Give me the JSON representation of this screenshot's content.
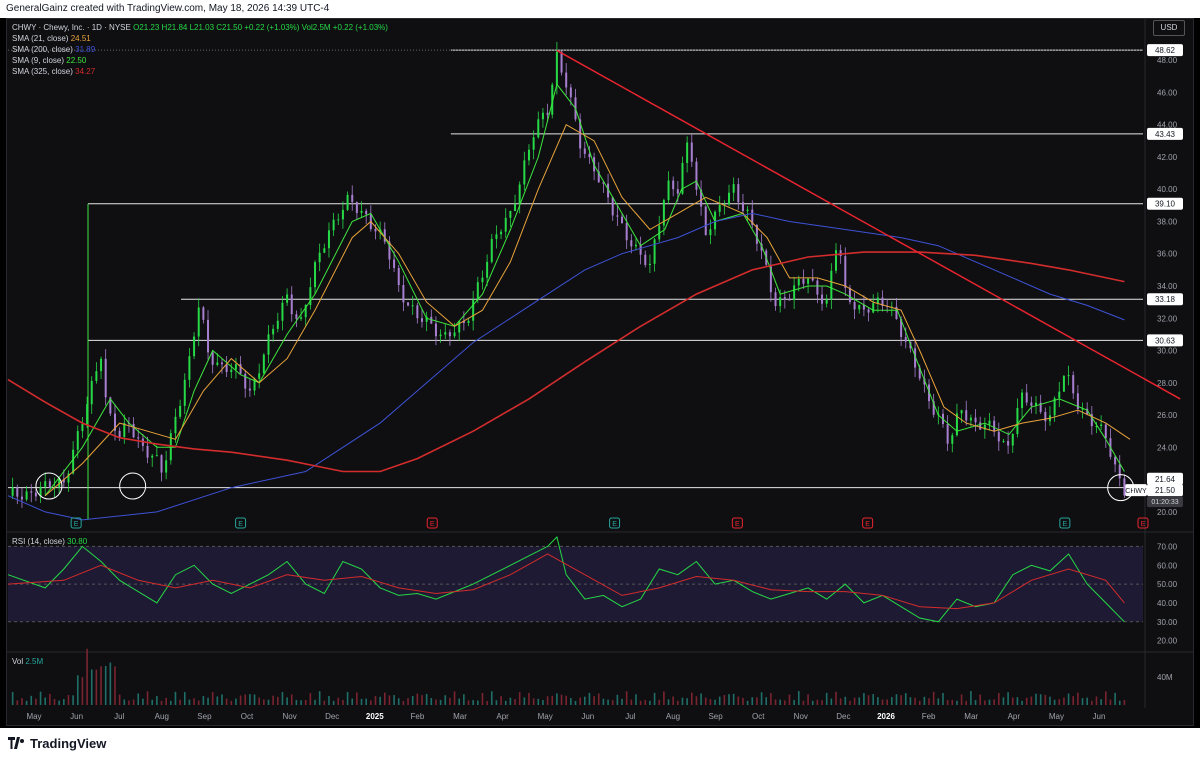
{
  "header": {
    "text": "GeneralGainz created with TradingView.com, May 18, 2026 14:39 UTC-4"
  },
  "legend": {
    "symbol_line": "CHWY · Chewy, Inc. · 1D · NYSE",
    "ohlc": "O21.23 H21.84 L21.03 C21.50 +0.22 (+1.03%) Vol2.5M +0.22 (+1.03%)",
    "sma1_label": "SMA (21, close)",
    "sma1_value": "24.51",
    "sma2_label": "SMA (200, close)",
    "sma2_value": "31.89",
    "sma3_label": "SMA (9, close)",
    "sma3_value": "22.50",
    "sma4_label": "SMA (325, close)",
    "sma4_value": "34.27"
  },
  "currency": "USD",
  "rsi_label": "RSI (14, close)",
  "rsi_value": "30.80",
  "vol_label": "Vol",
  "vol_value": "2.5M",
  "footer": {
    "brand": "TradingView"
  },
  "colors": {
    "up": "#26d946",
    "down": "#a87fd0",
    "sma21": "#e8a33a",
    "sma200": "#3d52d5",
    "sma9": "#3ee63e",
    "sma325": "#d32c2c",
    "trendline": "#e8242e",
    "rsi": "#26d946",
    "rsi_ma": "#d32c2c"
  },
  "chart_data": {
    "type": "line",
    "title": "CHWY · Chewy, Inc. · 1D · NYSE",
    "x_axis": {
      "ticks": [
        "May",
        "Jun",
        "Jul",
        "Aug",
        "Sep",
        "Oct",
        "Nov",
        "Dec",
        "2025",
        "Feb",
        "Mar",
        "Apr",
        "May",
        "Jun",
        "Jul",
        "Aug",
        "Sep",
        "Oct",
        "Nov",
        "Dec",
        "2026",
        "Feb",
        "Mar",
        "Apr",
        "May",
        "Jun"
      ],
      "bold_ticks": [
        "2025",
        "2026"
      ]
    },
    "y_axis": {
      "range": [
        19,
        49
      ],
      "ticks": [
        20,
        22,
        24,
        26,
        28,
        30,
        32,
        34,
        36,
        38,
        40,
        42,
        44,
        46,
        48
      ]
    },
    "price_path": [
      [
        0,
        21.0
      ],
      [
        2,
        21.4
      ],
      [
        3,
        22.0
      ],
      [
        4,
        25.5
      ],
      [
        5,
        30.0
      ],
      [
        5.3,
        26.5
      ],
      [
        6,
        24.5
      ],
      [
        6.5,
        25.5
      ],
      [
        7,
        24.5
      ],
      [
        8,
        23.0
      ],
      [
        8.3,
        22.3
      ],
      [
        9,
        26.0
      ],
      [
        9.8,
        29.5
      ],
      [
        10.3,
        33.0
      ],
      [
        10.7,
        30.0
      ],
      [
        11.5,
        29.0
      ],
      [
        12.5,
        28.5
      ],
      [
        13,
        27.5
      ],
      [
        14,
        30.5
      ],
      [
        15,
        33.5
      ],
      [
        15.7,
        31.5
      ],
      [
        16.6,
        35.5
      ],
      [
        17.2,
        37.5
      ],
      [
        18.3,
        39.2
      ],
      [
        19.2,
        38.5
      ],
      [
        20.3,
        36.5
      ],
      [
        21,
        34.0
      ],
      [
        22,
        32.0
      ],
      [
        23.5,
        31.0
      ],
      [
        24.6,
        31.5
      ],
      [
        25.2,
        34.0
      ],
      [
        26,
        36.5
      ],
      [
        27,
        38.5
      ],
      [
        27.6,
        41.0
      ],
      [
        28.3,
        43.5
      ],
      [
        29,
        45.0
      ],
      [
        29.5,
        48.4
      ],
      [
        30,
        46.5
      ],
      [
        30.8,
        42.5
      ],
      [
        31.5,
        41.5
      ],
      [
        32.5,
        38.5
      ],
      [
        33.4,
        37.0
      ],
      [
        34.5,
        35.0
      ],
      [
        35.4,
        40.5
      ],
      [
        36,
        40.0
      ],
      [
        36.6,
        43.0
      ],
      [
        37,
        40.0
      ],
      [
        37.5,
        37.5
      ],
      [
        38.4,
        39.0
      ],
      [
        39,
        40.0
      ],
      [
        39.8,
        38.5
      ],
      [
        40.6,
        35.5
      ],
      [
        41.2,
        33.0
      ],
      [
        42,
        33.5
      ],
      [
        43,
        34.5
      ],
      [
        44,
        33.0
      ],
      [
        44.6,
        37.0
      ],
      [
        45,
        33.5
      ],
      [
        46,
        32.5
      ],
      [
        47.3,
        33.0
      ],
      [
        47.8,
        32.0
      ],
      [
        48.2,
        30.5
      ],
      [
        49.3,
        27.5
      ],
      [
        50,
        26.0
      ],
      [
        50.6,
        24.0
      ],
      [
        51.2,
        26.5
      ],
      [
        52,
        25.5
      ],
      [
        53,
        25.0
      ],
      [
        53.7,
        24.0
      ],
      [
        54.4,
        27.0
      ],
      [
        55.2,
        26.5
      ],
      [
        56,
        26.0
      ],
      [
        56.8,
        28.5
      ],
      [
        57.4,
        27.0
      ],
      [
        58,
        26.0
      ],
      [
        59,
        24.5
      ],
      [
        59.6,
        22.5
      ],
      [
        60,
        21.5
      ]
    ],
    "series": [
      {
        "name": "SMA (9, close)",
        "values": [
          [
            2,
            21.0
          ],
          [
            4,
            24.0
          ],
          [
            5.5,
            27.0
          ],
          [
            6.5,
            25.5
          ],
          [
            8,
            24.0
          ],
          [
            9,
            24.0
          ],
          [
            10,
            27.5
          ],
          [
            11,
            30.0
          ],
          [
            12.5,
            28.5
          ],
          [
            13.5,
            28.0
          ],
          [
            15,
            31.0
          ],
          [
            16.5,
            33.5
          ],
          [
            18.5,
            38.0
          ],
          [
            19.5,
            38.5
          ],
          [
            21,
            35.5
          ],
          [
            22.5,
            32.0
          ],
          [
            24,
            31.5
          ],
          [
            25.5,
            33.5
          ],
          [
            27,
            37.5
          ],
          [
            28.5,
            42.0
          ],
          [
            29.5,
            46.5
          ],
          [
            30.5,
            45.0
          ],
          [
            31.5,
            41.5
          ],
          [
            33,
            38.5
          ],
          [
            34,
            36.5
          ],
          [
            35.3,
            37.5
          ],
          [
            36.2,
            40.0
          ],
          [
            37,
            40.5
          ],
          [
            38,
            38.0
          ],
          [
            39.5,
            38.5
          ],
          [
            40.5,
            36.5
          ],
          [
            41.5,
            33.5
          ],
          [
            43,
            34.0
          ],
          [
            44,
            34.0
          ],
          [
            45,
            33.5
          ],
          [
            46.5,
            32.5
          ],
          [
            47.8,
            32.5
          ],
          [
            48.8,
            29.5
          ],
          [
            50,
            26.0
          ],
          [
            51,
            25.0
          ],
          [
            52.5,
            25.5
          ],
          [
            53.8,
            24.8
          ],
          [
            55,
            26.5
          ],
          [
            56.5,
            27.0
          ],
          [
            58,
            26.3
          ],
          [
            59,
            24.5
          ],
          [
            60,
            22.5
          ]
        ]
      },
      {
        "name": "SMA (21, close)",
        "values": [
          [
            2,
            21.0
          ],
          [
            4,
            23.0
          ],
          [
            6,
            25.5
          ],
          [
            7.5,
            25.0
          ],
          [
            9,
            24.5
          ],
          [
            10.5,
            27.5
          ],
          [
            12,
            29.5
          ],
          [
            13.5,
            28.0
          ],
          [
            15,
            29.5
          ],
          [
            16.5,
            32.5
          ],
          [
            18.5,
            37.0
          ],
          [
            19.5,
            38.0
          ],
          [
            21,
            36.0
          ],
          [
            22.5,
            33.0
          ],
          [
            24,
            31.5
          ],
          [
            25.5,
            32.5
          ],
          [
            27,
            35.5
          ],
          [
            28.5,
            40.0
          ],
          [
            30,
            44.0
          ],
          [
            31.5,
            43.0
          ],
          [
            33,
            39.5
          ],
          [
            34.5,
            37.5
          ],
          [
            36,
            38.5
          ],
          [
            37.5,
            39.5
          ],
          [
            39.5,
            38.5
          ],
          [
            40.8,
            37.0
          ],
          [
            42,
            34.5
          ],
          [
            43.5,
            34.5
          ],
          [
            45,
            34.0
          ],
          [
            46.5,
            33.0
          ],
          [
            48,
            32.5
          ],
          [
            49,
            30.0
          ],
          [
            50.3,
            26.5
          ],
          [
            51.5,
            25.5
          ],
          [
            53,
            25.0
          ],
          [
            54.5,
            25.5
          ],
          [
            56,
            25.8
          ],
          [
            57.5,
            26.3
          ],
          [
            59,
            25.5
          ],
          [
            60.3,
            24.5
          ]
        ]
      },
      {
        "name": "SMA (200, close)",
        "values": [
          [
            0,
            21.0
          ],
          [
            2,
            20.0
          ],
          [
            4,
            19.5
          ],
          [
            8,
            20.0
          ],
          [
            12,
            21.5
          ],
          [
            16,
            22.5
          ],
          [
            18,
            24.0
          ],
          [
            20,
            25.5
          ],
          [
            22,
            27.5
          ],
          [
            25,
            30.5
          ],
          [
            27,
            32.0
          ],
          [
            29,
            33.5
          ],
          [
            31,
            35.0
          ],
          [
            33,
            36.0
          ],
          [
            34.5,
            36.5
          ],
          [
            36,
            37.0
          ],
          [
            38,
            38.0
          ],
          [
            40,
            38.5
          ],
          [
            42,
            38.0
          ],
          [
            45,
            37.5
          ],
          [
            48,
            37.0
          ],
          [
            50,
            36.5
          ],
          [
            52,
            35.5
          ],
          [
            54,
            34.5
          ],
          [
            56,
            33.5
          ],
          [
            58,
            32.8
          ],
          [
            60,
            31.9
          ]
        ]
      },
      {
        "name": "SMA (325, close)",
        "values": [
          [
            0,
            28.2
          ],
          [
            2,
            26.8
          ],
          [
            4,
            25.5
          ],
          [
            6,
            24.6
          ],
          [
            8,
            24.2
          ],
          [
            10,
            23.9
          ],
          [
            12,
            23.7
          ],
          [
            15,
            23.2
          ],
          [
            18,
            22.5
          ],
          [
            20,
            22.5
          ],
          [
            22,
            23.3
          ],
          [
            25,
            25.0
          ],
          [
            28,
            27.0
          ],
          [
            31,
            29.3
          ],
          [
            34,
            31.5
          ],
          [
            37,
            33.5
          ],
          [
            40,
            35.0
          ],
          [
            43,
            35.8
          ],
          [
            46,
            36.1
          ],
          [
            49,
            36.1
          ],
          [
            52,
            35.9
          ],
          [
            55,
            35.4
          ],
          [
            57,
            35.0
          ],
          [
            60,
            34.27
          ]
        ]
      },
      {
        "name": "RSI (14, close)",
        "values": [
          [
            0,
            55
          ],
          [
            2,
            48
          ],
          [
            3,
            58
          ],
          [
            4,
            70
          ],
          [
            5,
            62
          ],
          [
            6,
            52
          ],
          [
            8,
            40
          ],
          [
            9,
            55
          ],
          [
            10,
            60
          ],
          [
            11,
            50
          ],
          [
            12,
            45
          ],
          [
            13,
            50
          ],
          [
            14,
            55
          ],
          [
            15,
            62
          ],
          [
            16,
            50
          ],
          [
            17,
            45
          ],
          [
            18,
            62
          ],
          [
            19,
            58
          ],
          [
            20,
            48
          ],
          [
            21,
            44
          ],
          [
            22,
            45
          ],
          [
            23,
            42
          ],
          [
            24,
            46
          ],
          [
            25,
            50
          ],
          [
            26,
            55
          ],
          [
            27,
            60
          ],
          [
            28,
            65
          ],
          [
            29,
            70
          ],
          [
            29.5,
            75
          ],
          [
            30,
            55
          ],
          [
            31,
            42
          ],
          [
            32,
            44
          ],
          [
            33,
            38
          ],
          [
            34,
            42
          ],
          [
            35,
            58
          ],
          [
            36,
            55
          ],
          [
            37,
            62
          ],
          [
            38,
            50
          ],
          [
            39,
            52
          ],
          [
            40,
            46
          ],
          [
            41,
            42
          ],
          [
            42,
            45
          ],
          [
            43,
            48
          ],
          [
            44,
            42
          ],
          [
            45,
            50
          ],
          [
            46,
            40
          ],
          [
            47,
            44
          ],
          [
            48,
            38
          ],
          [
            49,
            32
          ],
          [
            50,
            30
          ],
          [
            51,
            42
          ],
          [
            52,
            38
          ],
          [
            53,
            40
          ],
          [
            54,
            55
          ],
          [
            55,
            60
          ],
          [
            56,
            57
          ],
          [
            57,
            66
          ],
          [
            58,
            50
          ],
          [
            59,
            40
          ],
          [
            60,
            30
          ]
        ]
      },
      {
        "name": "RSI-based MA",
        "values": [
          [
            0,
            50
          ],
          [
            3,
            52
          ],
          [
            5,
            60
          ],
          [
            7,
            52
          ],
          [
            9,
            48
          ],
          [
            11,
            52
          ],
          [
            13,
            48
          ],
          [
            15,
            55
          ],
          [
            17,
            52
          ],
          [
            19,
            54
          ],
          [
            21,
            48
          ],
          [
            23,
            45
          ],
          [
            25,
            47
          ],
          [
            27,
            55
          ],
          [
            29,
            66
          ],
          [
            31,
            55
          ],
          [
            33,
            44
          ],
          [
            35,
            48
          ],
          [
            37,
            54
          ],
          [
            39,
            52
          ],
          [
            41,
            47
          ],
          [
            43,
            46
          ],
          [
            45,
            46
          ],
          [
            47,
            44
          ],
          [
            49,
            38
          ],
          [
            51,
            37
          ],
          [
            53,
            40
          ],
          [
            55,
            52
          ],
          [
            57,
            58
          ],
          [
            59,
            52
          ],
          [
            60,
            40
          ]
        ]
      }
    ],
    "horizontal_levels": [
      21.5,
      30.63,
      33.18,
      39.1,
      43.43,
      48.62
    ],
    "price_labels": [
      "48.62",
      "43.43",
      "39.10",
      "33.18",
      "30.63",
      "21.64",
      "21.50"
    ],
    "last_label": "CHWY",
    "countdown": "01:20:33",
    "trendline": {
      "from": [
        29.5,
        48.6
      ],
      "to": [
        63,
        27.0
      ]
    },
    "earnings_markers": [
      "E",
      "E",
      "E",
      "E",
      "E",
      "E",
      "E",
      "E",
      "E"
    ],
    "rsi_axis": {
      "range": [
        15,
        75
      ],
      "ticks": [
        20,
        30,
        40,
        50,
        60,
        70
      ],
      "band": [
        30,
        70
      ]
    },
    "vol_axis_label": "40M",
    "months_span": 61
  }
}
